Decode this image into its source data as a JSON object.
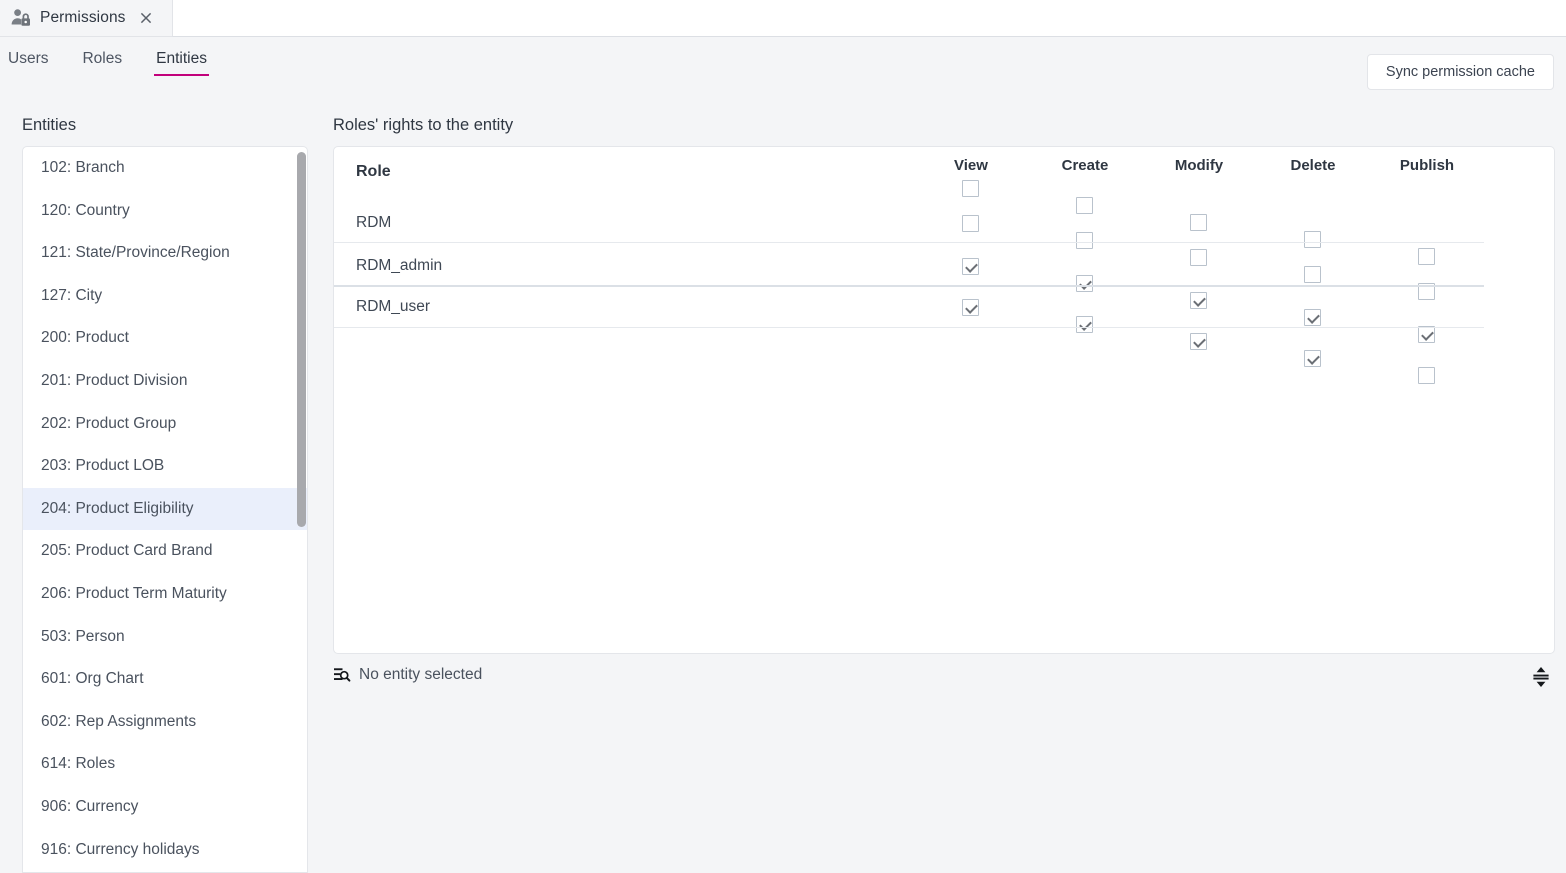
{
  "window": {
    "tab": {
      "title": "Permissions",
      "icon": "user-lock-icon",
      "close_icon": "close-icon"
    }
  },
  "subtabs": {
    "items": [
      {
        "label": "Users",
        "active": false
      },
      {
        "label": "Roles",
        "active": false
      },
      {
        "label": "Entities",
        "active": true
      }
    ],
    "active_underline_color": "#c2007b"
  },
  "toolbar": {
    "sync_button_label": "Sync permission cache"
  },
  "entities": {
    "heading": "Entities",
    "selected": "204: Product Eligibility",
    "items": [
      "102: Branch",
      "120: Country",
      "121: State/Province/Region",
      "127: City",
      "200: Product",
      "201: Product Division",
      "202: Product Group",
      "203: Product LOB",
      "204: Product Eligibility",
      "205: Product Card Brand",
      "206: Product Term Maturity",
      "503: Person",
      "601: Org Chart",
      "602: Rep Assignments",
      "614: Roles",
      "906: Currency",
      "916: Currency holidays"
    ]
  },
  "rights": {
    "heading": "Roles' rights to the entity",
    "role_column_header": "Role",
    "columns": [
      "View",
      "Create",
      "Modify",
      "Delete",
      "Publish"
    ],
    "header_checkboxes": [
      false,
      false,
      false,
      false,
      false
    ],
    "rows": [
      {
        "role": "RDM",
        "values": [
          false,
          false,
          false,
          false,
          false
        ]
      },
      {
        "role": "RDM_admin",
        "values": [
          true,
          true,
          true,
          true,
          true
        ]
      },
      {
        "role": "RDM_user",
        "values": [
          true,
          true,
          true,
          true,
          false
        ]
      }
    ]
  },
  "statusbar": {
    "icon": "find-entity-icon",
    "text": "No entity selected",
    "resize_icon": "vertical-resize-icon"
  }
}
